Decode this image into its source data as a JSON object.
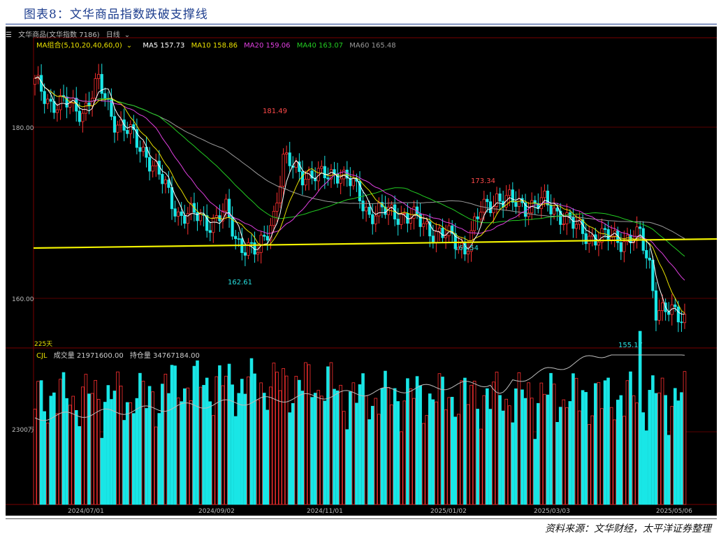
{
  "figure_title": "图表8：文华商品指数跌破支撑线",
  "source_note": "资料来源：文华财经，太平洋证券整理",
  "header": {
    "menu_icon": "hamburger-menu-icon",
    "instrument": "文华商品(文华指数 7186)",
    "period": "日线",
    "period_icon": "chevron-down-icon"
  },
  "ma_legend": {
    "combo_label": "MA组合(5,10,20,40,60,0)",
    "items": [
      {
        "text": "MA5 157.73",
        "color": "#ffffff"
      },
      {
        "text": "MA10 158.86",
        "color": "#e8e000"
      },
      {
        "text": "MA20 159.06",
        "color": "#e040e0"
      },
      {
        "text": "MA40 163.07",
        "color": "#22cc22"
      },
      {
        "text": "MA60 165.48",
        "color": "#9a9a9a"
      }
    ]
  },
  "volume_legend": {
    "name": "CJL",
    "volume": "成交量 21971600.00",
    "open_interest": "持仓量 34767184.00"
  },
  "price_axis": [
    "180.00",
    "160.00"
  ],
  "volume_axis": "2300万",
  "days_label": "225天",
  "dates": [
    "2024/07/01",
    "2024/09/02",
    "2024/11/01",
    "2025/01/02",
    "2025/03/03",
    "2025/05/06"
  ],
  "annotations": [
    {
      "text": "181.49",
      "color": "#ff4a4a"
    },
    {
      "text": "173.34",
      "color": "#ff4a4a"
    },
    {
      "text": "162.61",
      "color": "#27e0e0"
    },
    {
      "text": "166.54",
      "color": "#27e0e0"
    },
    {
      "text": "155.17",
      "color": "#27e0e0"
    }
  ],
  "colors": {
    "up": "#ff3030",
    "down": "#19e6e6",
    "support_line": "#f2f200",
    "background": "#000000"
  }
}
